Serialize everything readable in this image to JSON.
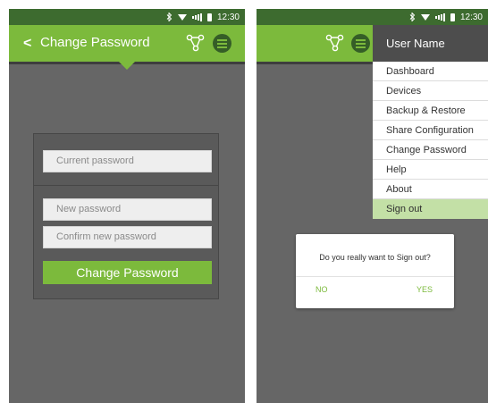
{
  "status_bar": {
    "time": "12:30"
  },
  "left_screen": {
    "title": "Change Password",
    "back_glyph": "<",
    "icons": {
      "back": "back-arrow-icon",
      "share": "share-config-icon",
      "menu": "hamburger-menu-icon"
    },
    "form": {
      "current_password_placeholder": "Current password",
      "new_password_placeholder": "New password",
      "confirm_password_placeholder": "Confirm new password",
      "submit_label": "Change Password"
    }
  },
  "right_screen": {
    "menu": {
      "header": "User Name",
      "items": [
        {
          "label": "Dashboard"
        },
        {
          "label": "Devices"
        },
        {
          "label": "Backup & Restore"
        },
        {
          "label": "Share Configuration"
        },
        {
          "label": "Change Password"
        },
        {
          "label": "Help"
        },
        {
          "label": "About"
        },
        {
          "label": "Sign out",
          "active": true
        }
      ]
    },
    "dialog": {
      "message": "Do you really want to Sign out?",
      "no_label": "NO",
      "yes_label": "YES"
    }
  },
  "colors": {
    "accent_green": "#7cba3c",
    "status_bar": "#3d6b2f",
    "backdrop": "#666666",
    "menu_header": "#4d4d4d",
    "active_menu_item": "#c3e0a6"
  }
}
